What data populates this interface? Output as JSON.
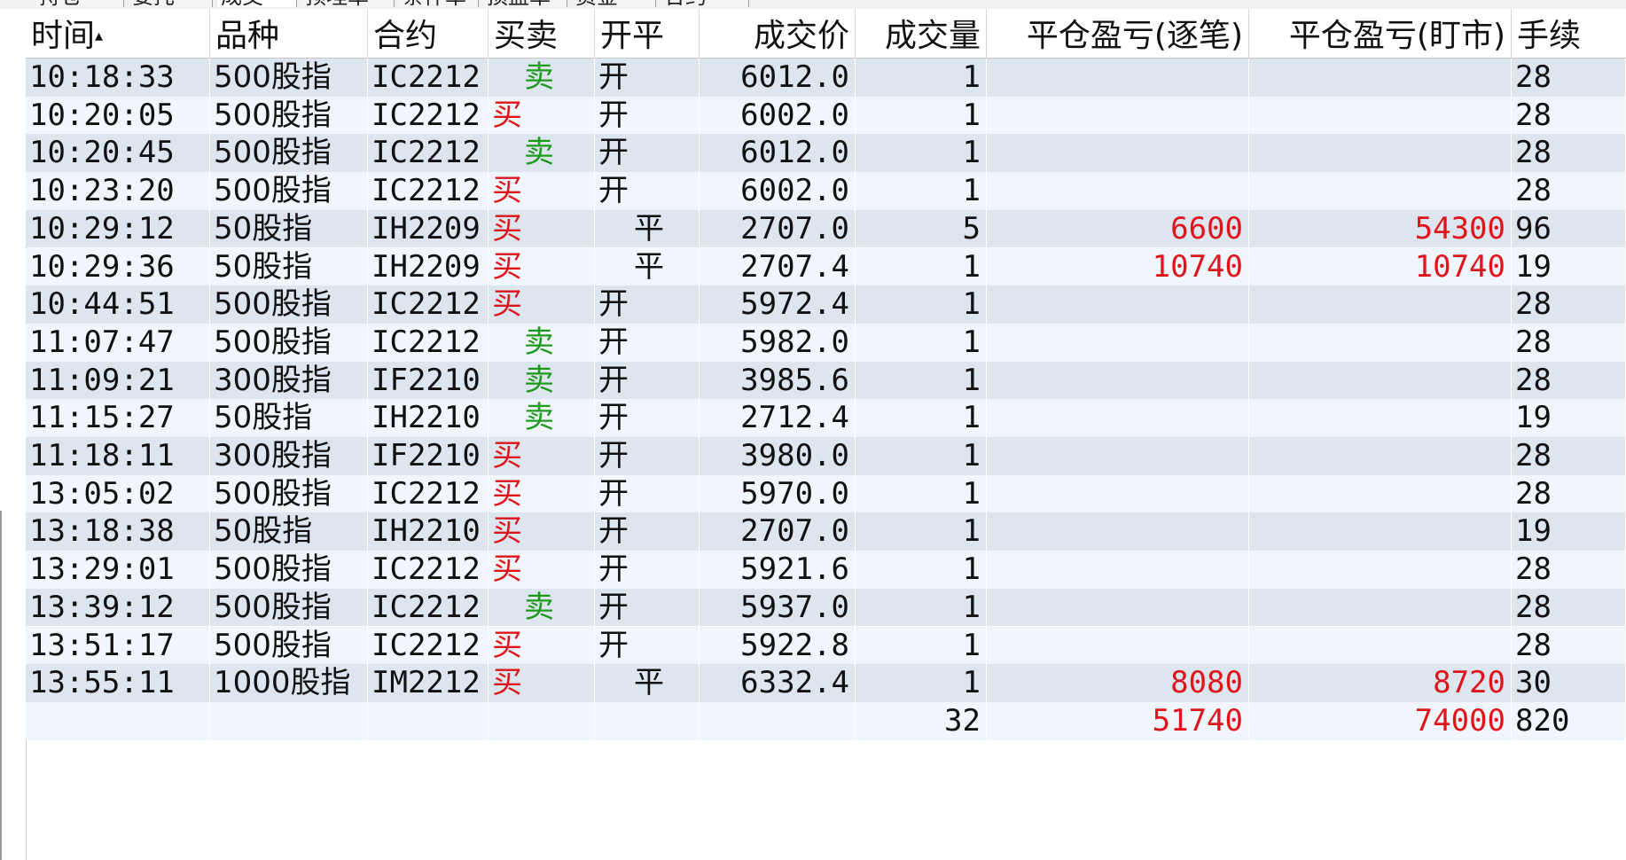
{
  "tabs": [
    "持仓",
    "委托",
    "成交",
    "预埋单",
    "条件单",
    "损盈单",
    "资金",
    "合约"
  ],
  "active_tab_index": 2,
  "colors": {
    "buy": "#e0141b",
    "sell": "#1f9a1f",
    "row_odd": "#dde5ee",
    "row_even": "#f1f6fc"
  },
  "table": {
    "headers": {
      "time": "时间",
      "variety": "品种",
      "contract": "合约",
      "buy_sell": "买卖",
      "open_close": "开平",
      "price": "成交价",
      "qty": "成交量",
      "close_pl_trade": "平仓盈亏(逐笔)",
      "close_pl_mark": "平仓盈亏(盯市)",
      "fee": "手续"
    },
    "rows": [
      {
        "time": "10:18:33",
        "variety": "500股指",
        "contract": "IC2212",
        "bs": "卖",
        "oc": "开",
        "price": "6012.0",
        "qty": "1",
        "pl1": "",
        "pl2": "",
        "fee": "28"
      },
      {
        "time": "10:20:05",
        "variety": "500股指",
        "contract": "IC2212",
        "bs": "买",
        "oc": "开",
        "price": "6002.0",
        "qty": "1",
        "pl1": "",
        "pl2": "",
        "fee": "28"
      },
      {
        "time": "10:20:45",
        "variety": "500股指",
        "contract": "IC2212",
        "bs": "卖",
        "oc": "开",
        "price": "6012.0",
        "qty": "1",
        "pl1": "",
        "pl2": "",
        "fee": "28"
      },
      {
        "time": "10:23:20",
        "variety": "500股指",
        "contract": "IC2212",
        "bs": "买",
        "oc": "开",
        "price": "6002.0",
        "qty": "1",
        "pl1": "",
        "pl2": "",
        "fee": "28"
      },
      {
        "time": "10:29:12",
        "variety": "50股指",
        "contract": "IH2209",
        "bs": "买",
        "oc": "平",
        "price": "2707.0",
        "qty": "5",
        "pl1": "6600",
        "pl2": "54300",
        "fee": "96"
      },
      {
        "time": "10:29:36",
        "variety": "50股指",
        "contract": "IH2209",
        "bs": "买",
        "oc": "平",
        "price": "2707.4",
        "qty": "1",
        "pl1": "10740",
        "pl2": "10740",
        "fee": "19"
      },
      {
        "time": "10:44:51",
        "variety": "500股指",
        "contract": "IC2212",
        "bs": "买",
        "oc": "开",
        "price": "5972.4",
        "qty": "1",
        "pl1": "",
        "pl2": "",
        "fee": "28"
      },
      {
        "time": "11:07:47",
        "variety": "500股指",
        "contract": "IC2212",
        "bs": "卖",
        "oc": "开",
        "price": "5982.0",
        "qty": "1",
        "pl1": "",
        "pl2": "",
        "fee": "28"
      },
      {
        "time": "11:09:21",
        "variety": "300股指",
        "contract": "IF2210",
        "bs": "卖",
        "oc": "开",
        "price": "3985.6",
        "qty": "1",
        "pl1": "",
        "pl2": "",
        "fee": "28"
      },
      {
        "time": "11:15:27",
        "variety": "50股指",
        "contract": "IH2210",
        "bs": "卖",
        "oc": "开",
        "price": "2712.4",
        "qty": "1",
        "pl1": "",
        "pl2": "",
        "fee": "19"
      },
      {
        "time": "11:18:11",
        "variety": "300股指",
        "contract": "IF2210",
        "bs": "买",
        "oc": "开",
        "price": "3980.0",
        "qty": "1",
        "pl1": "",
        "pl2": "",
        "fee": "28"
      },
      {
        "time": "13:05:02",
        "variety": "500股指",
        "contract": "IC2212",
        "bs": "买",
        "oc": "开",
        "price": "5970.0",
        "qty": "1",
        "pl1": "",
        "pl2": "",
        "fee": "28"
      },
      {
        "time": "13:18:38",
        "variety": "50股指",
        "contract": "IH2210",
        "bs": "买",
        "oc": "开",
        "price": "2707.0",
        "qty": "1",
        "pl1": "",
        "pl2": "",
        "fee": "19"
      },
      {
        "time": "13:29:01",
        "variety": "500股指",
        "contract": "IC2212",
        "bs": "买",
        "oc": "开",
        "price": "5921.6",
        "qty": "1",
        "pl1": "",
        "pl2": "",
        "fee": "28"
      },
      {
        "time": "13:39:12",
        "variety": "500股指",
        "contract": "IC2212",
        "bs": "卖",
        "oc": "开",
        "price": "5937.0",
        "qty": "1",
        "pl1": "",
        "pl2": "",
        "fee": "28"
      },
      {
        "time": "13:51:17",
        "variety": "500股指",
        "contract": "IC2212",
        "bs": "买",
        "oc": "开",
        "price": "5922.8",
        "qty": "1",
        "pl1": "",
        "pl2": "",
        "fee": "28"
      },
      {
        "time": "13:55:11",
        "variety": "1000股指",
        "contract": "IM2212",
        "bs": "买",
        "oc": "平",
        "price": "6332.4",
        "qty": "1",
        "pl1": "8080",
        "pl2": "8720",
        "fee": "30"
      }
    ],
    "totals": {
      "qty": "32",
      "pl1": "51740",
      "pl2": "74000",
      "fee": "820"
    }
  }
}
